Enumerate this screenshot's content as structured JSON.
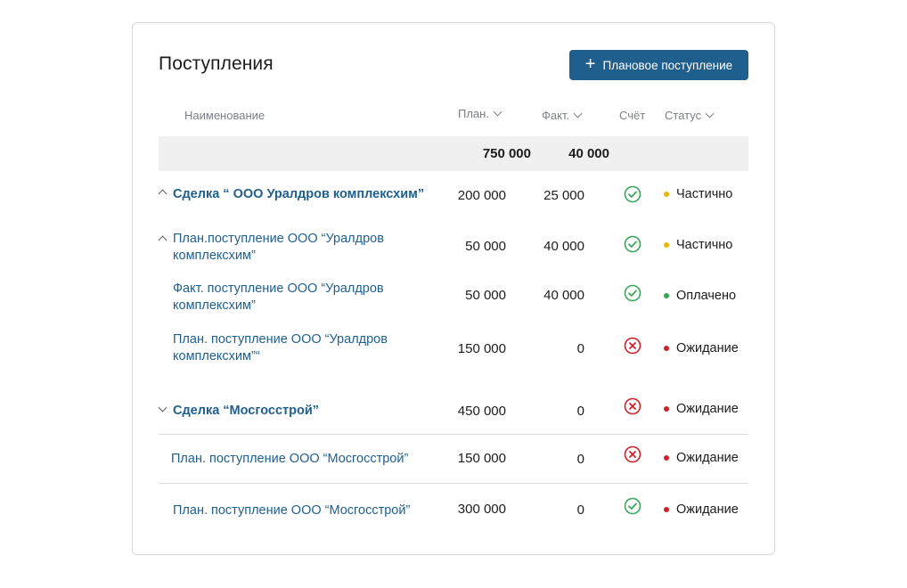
{
  "header": {
    "title": "Поступления",
    "add_button_label": "Плановое поступление"
  },
  "columns": {
    "name": "Наименование",
    "plan": "План.",
    "fact": "Факт.",
    "invoice": "Счёт",
    "status": "Статус"
  },
  "totals": {
    "plan": "750 000",
    "fact": "40 000"
  },
  "rows": [
    {
      "name_line1": "Сделка “ ООО Уралдров комплексхим”",
      "name_line2": "",
      "plan": "200 000",
      "fact": "25 000",
      "invoice": "check",
      "status": "Частично",
      "status_color": "#f0b400"
    },
    {
      "name_line1": "План.поступление ООО “Уралдров",
      "name_line2": "комплексхим”",
      "plan": "50 000",
      "fact": "40 000",
      "invoice": "check",
      "status": "Частично",
      "status_color": "#f0b400"
    },
    {
      "name_line1": "Факт. поступление ООО “Уралдров",
      "name_line2": "комплексхим”",
      "plan": "50 000",
      "fact": "40 000",
      "invoice": "check",
      "status": "Оплачено",
      "status_color": "#2fa84f"
    },
    {
      "name_line1": "План. поступление ООО “Уралдров",
      "name_line2": "комплексхим”“",
      "plan": "150 000",
      "fact": "0",
      "invoice": "cross",
      "status": "Ожидание",
      "status_color": "#d0202a"
    },
    {
      "name_line1": "Сделка “Мосгосстрой”",
      "name_line2": "",
      "plan": "450 000",
      "fact": "0",
      "invoice": "cross",
      "status": "Ожидание",
      "status_color": "#d0202a"
    },
    {
      "name_line1": "План. поступление ООО “Мосгосстрой”",
      "name_line2": "",
      "plan": "150 000",
      "fact": "0",
      "invoice": "cross",
      "status": "Ожидание",
      "status_color": "#d0202a"
    },
    {
      "name_line1": "План. поступление ООО “Мосгосстрой”",
      "name_line2": "",
      "plan": "300 000",
      "fact": "0",
      "invoice": "check",
      "status": "Ожидание",
      "status_color": "#d0202a"
    }
  ],
  "colors": {
    "accent": "#1f5f8e",
    "check": "#3aa75a",
    "cross": "#d0202a"
  }
}
